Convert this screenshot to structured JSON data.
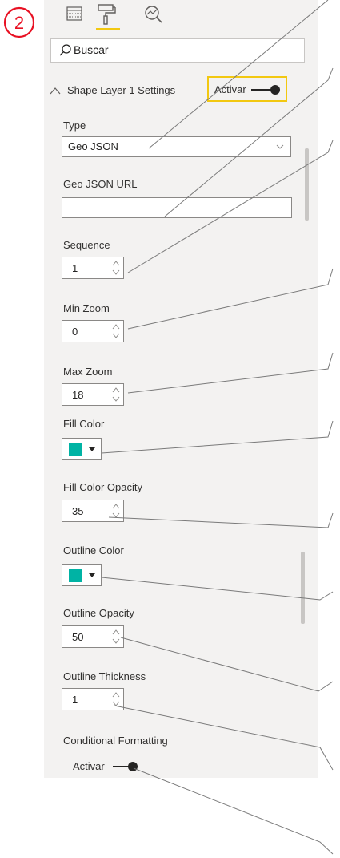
{
  "step_badge": "2",
  "search": {
    "placeholder": "Buscar"
  },
  "section": {
    "title": "Shape Layer 1 Settings",
    "toggle_label": "Activar"
  },
  "fields": {
    "type": {
      "label": "Type",
      "value": "Geo JSON"
    },
    "geojson_url": {
      "label": "Geo JSON URL",
      "value": ""
    },
    "sequence": {
      "label": "Sequence",
      "value": "1"
    },
    "min_zoom": {
      "label": "Min Zoom",
      "value": "0"
    },
    "max_zoom": {
      "label": "Max Zoom",
      "value": "18"
    },
    "fill_color": {
      "label": "Fill Color"
    },
    "fill_opacity": {
      "label": "Fill Color Opacity",
      "value": "35"
    },
    "outline_color": {
      "label": "Outline Color"
    },
    "outline_opacity": {
      "label": "Outline Opacity",
      "value": "50"
    },
    "outline_thickness": {
      "label": "Outline Thickness",
      "value": "1"
    },
    "conditional": {
      "label": "Conditional Formatting",
      "toggle_label": "Activar"
    }
  },
  "colors": {
    "swatch": "#00b3a4",
    "highlight": "#f2c811",
    "badge": "#e81123"
  }
}
